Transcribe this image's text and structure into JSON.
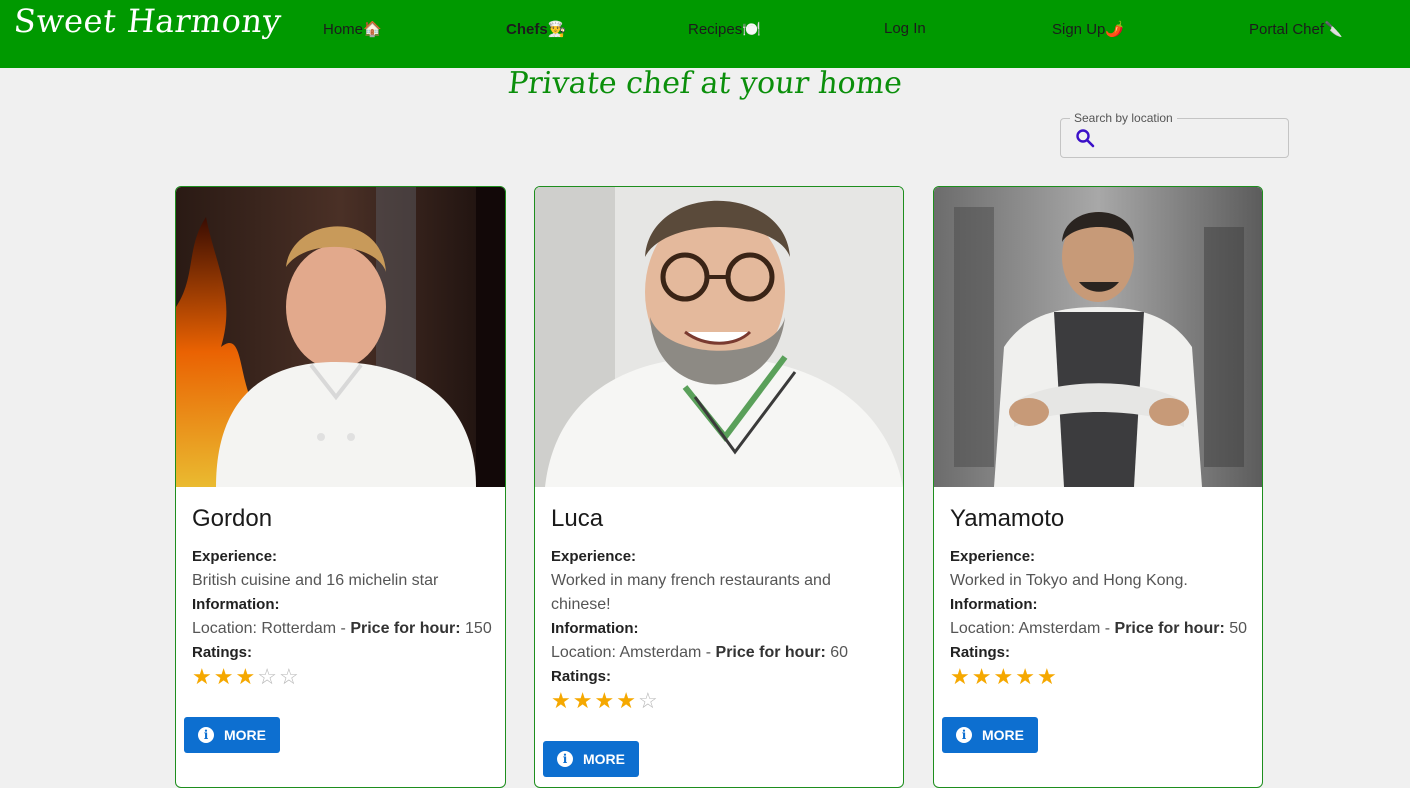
{
  "brand": "Sweet Harmony",
  "nav": [
    {
      "label": "Home🏠"
    },
    {
      "label": "Chefs👨‍🍳"
    },
    {
      "label": "Recipes🍽️"
    },
    {
      "label": "Log In"
    },
    {
      "label": "Sign Up🌶️"
    },
    {
      "label": "Portal Chef🔪"
    }
  ],
  "hero_title": "Private chef at your home",
  "search": {
    "label": "Search by location",
    "value": ""
  },
  "colors": {
    "nav_bg": "#009900",
    "accent_green": "#0b8f0b",
    "button_blue": "#0d6fd0",
    "star": "#f5a800"
  },
  "chefs": [
    {
      "name": "Gordon",
      "experience_label": "Experience:",
      "experience": "British cuisine and 16 michelin star",
      "information_label": "Information:",
      "location_label": "Location:",
      "location": "Rotterdam",
      "price_label": "Price for hour:",
      "price": "150",
      "ratings_label": "Ratings:",
      "rating": 3,
      "more_label": "MORE"
    },
    {
      "name": "Luca",
      "experience_label": "Experience:",
      "experience": "Worked in many french restaurants and chinese!",
      "information_label": "Information:",
      "location_label": "Location:",
      "location": "Amsterdam",
      "price_label": "Price for hour:",
      "price": "60",
      "ratings_label": "Ratings:",
      "rating": 4,
      "more_label": "MORE"
    },
    {
      "name": "Yamamoto",
      "experience_label": "Experience:",
      "experience": "Worked in Tokyo and Hong Kong.",
      "information_label": "Information:",
      "location_label": "Location:",
      "location": "Amsterdam",
      "price_label": "Price for hour:",
      "price": "50",
      "ratings_label": "Ratings:",
      "rating": 5,
      "more_label": "MORE"
    }
  ],
  "separator": "-",
  "rating_max": 5
}
